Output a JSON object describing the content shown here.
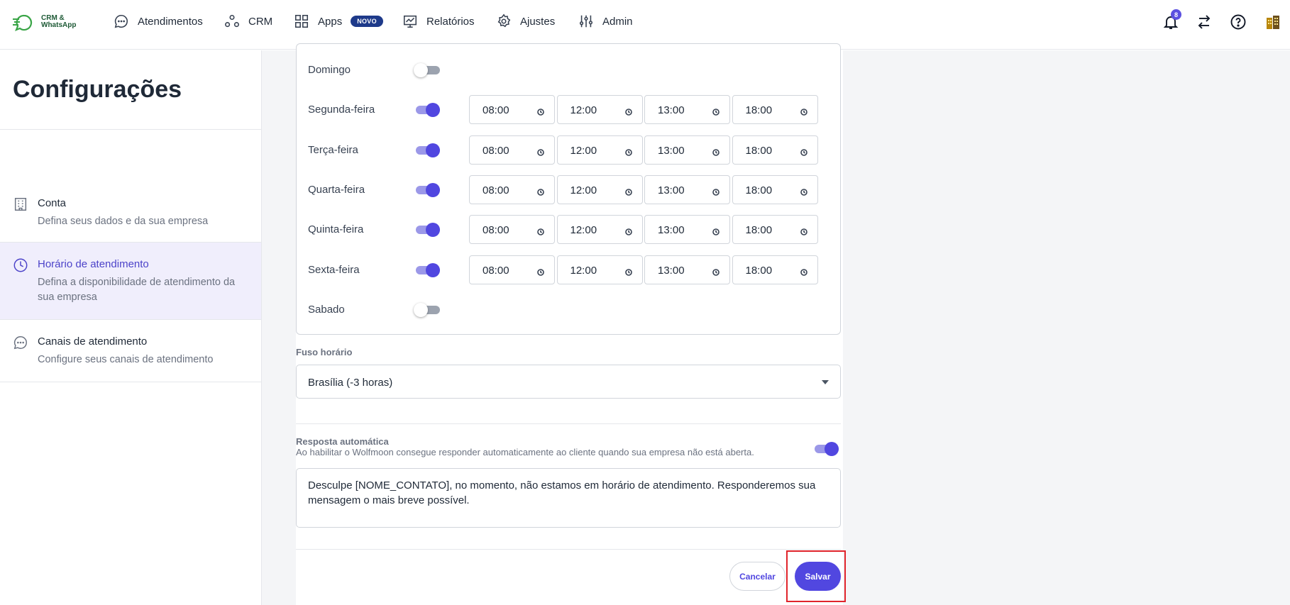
{
  "brand": {
    "line1": "CRM &",
    "line2": "WhatsApp"
  },
  "nav": {
    "atendimentos": "Atendimentos",
    "crm": "CRM",
    "apps": "Apps",
    "apps_badge": "NOVO",
    "relatorios": "Relatórios",
    "ajustes": "Ajustes",
    "admin": "Admin"
  },
  "notifications": {
    "count": "8"
  },
  "sidebar": {
    "title": "Configurações",
    "items": [
      {
        "title": "Conta",
        "desc": "Defina seus dados e da sua empresa"
      },
      {
        "title": "Horário de atendimento",
        "desc": "Defina a disponibilidade de atendimento da sua empresa"
      },
      {
        "title": "Canais de atendimento",
        "desc": "Configure seus canais de atendimento"
      }
    ]
  },
  "schedule": [
    {
      "day": "Domingo",
      "enabled": false,
      "times": []
    },
    {
      "day": "Segunda-feira",
      "enabled": true,
      "times": [
        "08:00",
        "12:00",
        "13:00",
        "18:00"
      ]
    },
    {
      "day": "Terça-feira",
      "enabled": true,
      "times": [
        "08:00",
        "12:00",
        "13:00",
        "18:00"
      ]
    },
    {
      "day": "Quarta-feira",
      "enabled": true,
      "times": [
        "08:00",
        "12:00",
        "13:00",
        "18:00"
      ]
    },
    {
      "day": "Quinta-feira",
      "enabled": true,
      "times": [
        "08:00",
        "12:00",
        "13:00",
        "18:00"
      ]
    },
    {
      "day": "Sexta-feira",
      "enabled": true,
      "times": [
        "08:00",
        "12:00",
        "13:00",
        "18:00"
      ]
    },
    {
      "day": "Sabado",
      "enabled": false,
      "times": []
    }
  ],
  "timezone": {
    "label": "Fuso horário",
    "value": "Brasília (-3 horas)"
  },
  "auto_reply": {
    "title": "Resposta automática",
    "desc": "Ao habilitar o Wolfmoon consegue responder automaticamente ao cliente quando sua empresa não está aberta.",
    "enabled": true,
    "message": "Desculpe [NOME_CONTATO], no momento, não estamos em horário de atendimento. Responderemos sua mensagem o mais breve possível."
  },
  "actions": {
    "cancel": "Cancelar",
    "save": "Salvar"
  },
  "colors": {
    "accent": "#5147e0",
    "highlight": "#e0242b",
    "badge": "#1e3a8a"
  }
}
